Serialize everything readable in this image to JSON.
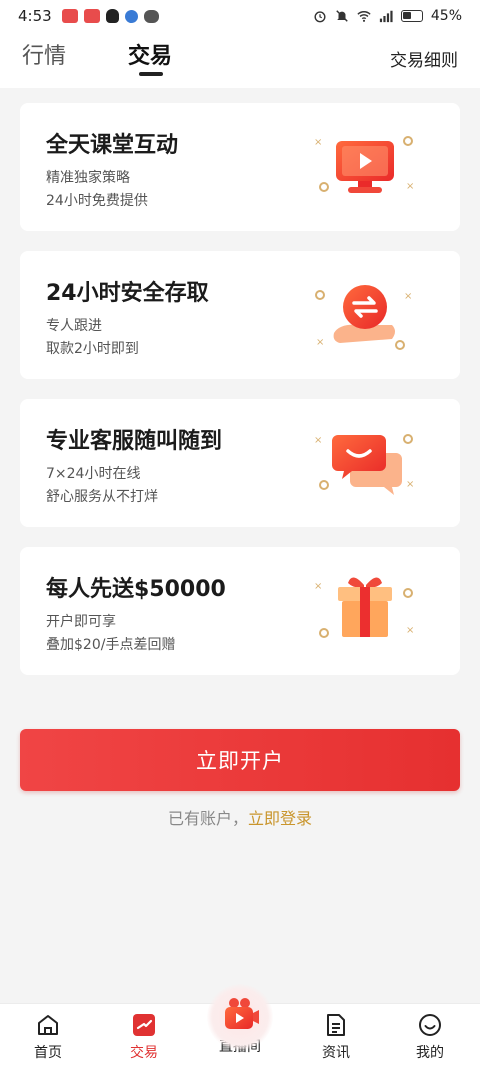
{
  "status_bar": {
    "time": "4:53",
    "battery": "45%"
  },
  "header": {
    "tab_market": "行情",
    "tab_trade": "交易",
    "rules_link": "交易细则"
  },
  "features": [
    {
      "title": "全天课堂互动",
      "line1": "精准独家策略",
      "line2": "24小时免费提供",
      "icon": "video-screen-icon"
    },
    {
      "title": "24小时安全存取",
      "line1": "专人跟进",
      "line2": "取款2小时即到",
      "icon": "exchange-arrows-icon"
    },
    {
      "title": "专业客服随叫随到",
      "line1": "7×24小时在线",
      "line2": "舒心服务从不打烊",
      "icon": "chat-bubble-icon"
    },
    {
      "title": "每人先送$50000",
      "line1": "开户即可享",
      "line2": "叠加$20/手点差回赠",
      "icon": "gift-box-icon"
    }
  ],
  "cta": {
    "open_account": "立即开户",
    "login_prompt": "已有账户，",
    "login_link": "立即登录"
  },
  "nav": {
    "home": "首页",
    "trade": "交易",
    "live": "直播间",
    "news": "资讯",
    "mine": "我的"
  },
  "colors": {
    "accent": "#e63030",
    "gold": "#c9952c"
  }
}
